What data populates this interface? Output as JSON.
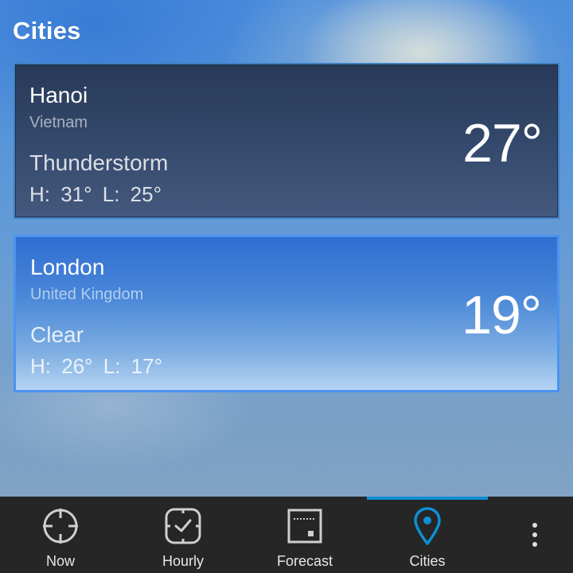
{
  "page": {
    "title": "Cities"
  },
  "cities": [
    {
      "city": "Hanoi",
      "country": "Vietnam",
      "condition": "Thunderstorm",
      "hilo": "H: 31°  L: 25°",
      "temperature": "27°"
    },
    {
      "city": "London",
      "country": "United Kingdom",
      "condition": "Clear",
      "hilo": "H: 26°  L: 17°",
      "temperature": "19°"
    }
  ],
  "tabbar": {
    "tabs": [
      {
        "label": "Now",
        "icon": "crosshair-icon"
      },
      {
        "label": "Hourly",
        "icon": "clock-icon"
      },
      {
        "label": "Forecast",
        "icon": "calendar-icon"
      },
      {
        "label": "Cities",
        "icon": "location-pin-icon"
      }
    ],
    "active_tab": "Cities",
    "overflow_icon": "more-vertical-icon"
  },
  "colors": {
    "accent": "#0c8fd4",
    "tabbar_background": "#262626",
    "selected_card_border": "#4a94ee"
  }
}
